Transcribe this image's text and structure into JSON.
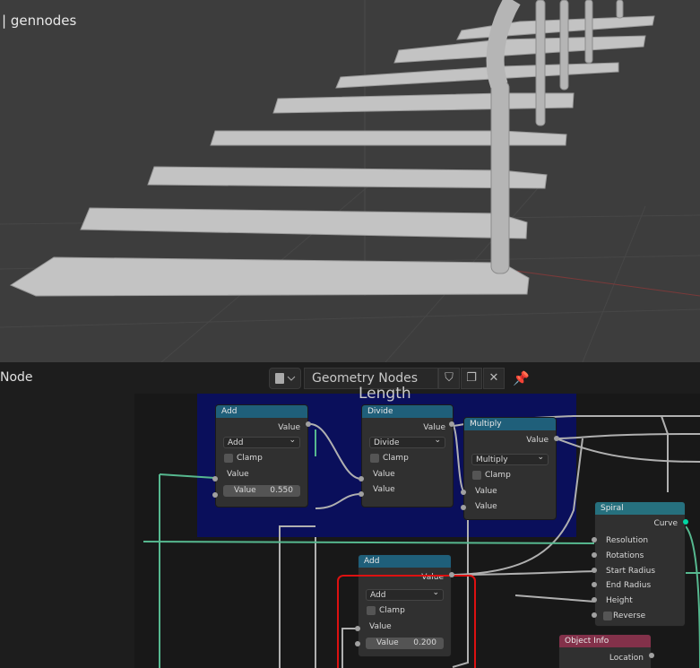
{
  "viewport": {
    "object_label": "| gennodes"
  },
  "header": {
    "editor_type": "Node",
    "node_tree_name": "Geometry Nodes",
    "close_label": "✕"
  },
  "frame": {
    "label": "Length"
  },
  "nodes": {
    "add1": {
      "title": "Add",
      "output": "Value",
      "operation": "Add",
      "clamp": "Clamp",
      "input1": "Value",
      "input2_label": "Value",
      "input2_value": "0.550"
    },
    "divide": {
      "title": "Divide",
      "output": "Value",
      "operation": "Divide",
      "clamp": "Clamp",
      "input1": "Value",
      "input2": "Value"
    },
    "multiply": {
      "title": "Multiply",
      "output": "Value",
      "operation": "Multiply",
      "clamp": "Clamp",
      "input1": "Value",
      "input2": "Value"
    },
    "add2": {
      "title": "Add",
      "output": "Value",
      "operation": "Add",
      "clamp": "Clamp",
      "input1": "Value",
      "input2_label": "Value",
      "input2_value": "0.200"
    },
    "spiral": {
      "title": "Spiral",
      "output": "Curve",
      "inputs": [
        "Resolution",
        "Rotations",
        "Start Radius",
        "End Radius",
        "Height"
      ],
      "reverse": "Reverse"
    },
    "object_info": {
      "title": "Object Info",
      "output": "Location"
    }
  },
  "colors": {
    "frame": "#0a0f5b",
    "math_header": "#1f5f7a",
    "geometry_header": "#26707e",
    "input_header": "#83314a",
    "selection": "#dd1111"
  }
}
